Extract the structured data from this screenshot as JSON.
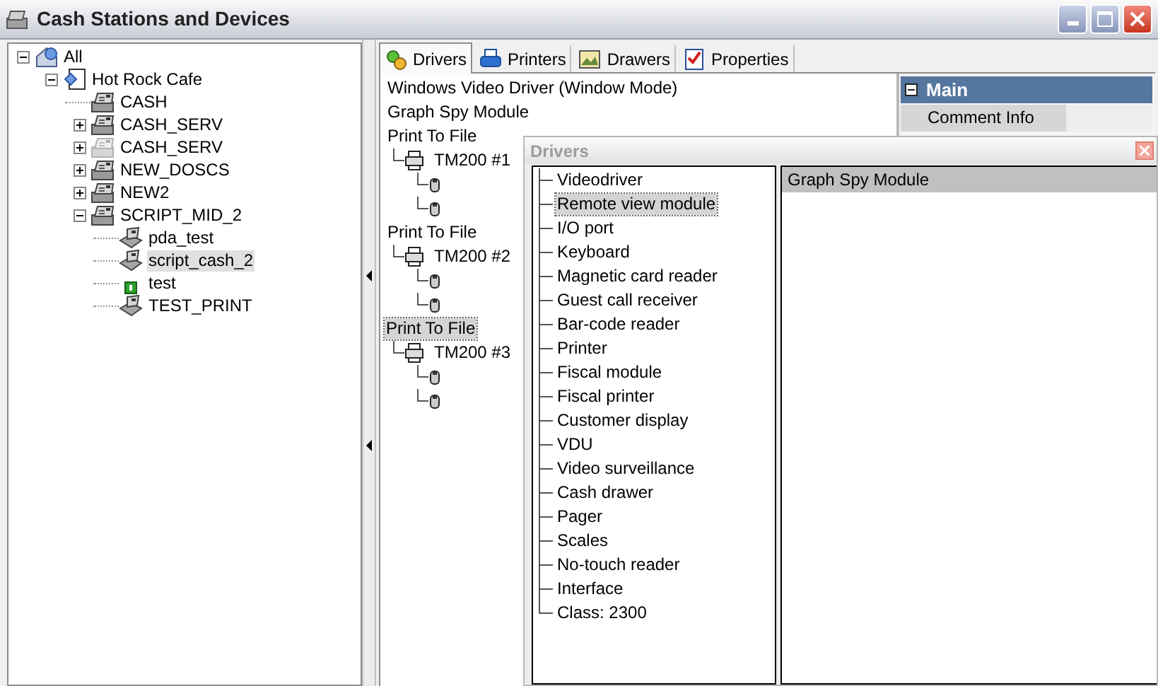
{
  "window": {
    "title": "Cash Stations and Devices"
  },
  "stations_tree": [
    {
      "label": "All",
      "kind": "root",
      "expanded": true,
      "selected": false,
      "children": [
        {
          "label": "Hot Rock Cafe",
          "kind": "site",
          "expanded": true,
          "selected": false,
          "children": [
            {
              "label": "CASH",
              "kind": "station",
              "selected": false,
              "disabled": false
            },
            {
              "label": "CASH_SERV",
              "kind": "station",
              "expanded": false,
              "selected": false,
              "disabled": false
            },
            {
              "label": "CASH_SERV",
              "kind": "station",
              "expanded": false,
              "selected": false,
              "disabled": true
            },
            {
              "label": "NEW_DOSCS",
              "kind": "station",
              "expanded": false,
              "selected": false,
              "disabled": false
            },
            {
              "label": "NEW2",
              "kind": "station",
              "expanded": false,
              "selected": false,
              "disabled": false
            },
            {
              "label": "SCRIPT_MID_2",
              "kind": "station",
              "expanded": true,
              "selected": false,
              "disabled": false,
              "children": [
                {
                  "label": "pda_test",
                  "kind": "terminal",
                  "selected": false
                },
                {
                  "label": "script_cash_2",
                  "kind": "terminal",
                  "selected": true
                },
                {
                  "label": "test",
                  "kind": "module",
                  "selected": false
                },
                {
                  "label": "TEST_PRINT",
                  "kind": "terminal",
                  "selected": false
                }
              ]
            }
          ]
        }
      ]
    }
  ],
  "tabs": [
    {
      "label": "Drivers",
      "kind": "drivers",
      "selected": true
    },
    {
      "label": "Printers",
      "kind": "printers",
      "selected": false
    },
    {
      "label": "Drawers",
      "kind": "drawers",
      "selected": false
    },
    {
      "label": "Properties",
      "kind": "properties",
      "selected": false
    }
  ],
  "drivers_tree": [
    {
      "label": "Windows Video Driver (Window Mode)",
      "selected": false
    },
    {
      "label": "Graph Spy Module",
      "selected": false
    },
    {
      "label": "Print To File",
      "selected": false,
      "children": [
        {
          "label": "TM200 #1",
          "kind": "printer",
          "selected": false,
          "children": [
            {
              "kind": "device"
            },
            {
              "kind": "device"
            }
          ]
        }
      ]
    },
    {
      "label": "Print To File",
      "selected": false,
      "children": [
        {
          "label": "TM200 #2",
          "kind": "printer",
          "selected": false,
          "children": [
            {
              "kind": "device"
            },
            {
              "kind": "device"
            }
          ]
        }
      ]
    },
    {
      "label": "Print To File",
      "selected": true,
      "children": [
        {
          "label": "TM200 #3",
          "kind": "printer",
          "selected": false,
          "children": [
            {
              "kind": "device"
            },
            {
              "kind": "device"
            }
          ]
        }
      ]
    }
  ],
  "properties": {
    "section": "Main",
    "rows": [
      "Comment Info"
    ]
  },
  "dialog": {
    "title": "Drivers",
    "classes": [
      {
        "label": "Videodriver",
        "selected": false
      },
      {
        "label": "Remote view module",
        "selected": true
      },
      {
        "label": "I/O port",
        "selected": false
      },
      {
        "label": "Keyboard",
        "selected": false
      },
      {
        "label": "Magnetic card reader",
        "selected": false
      },
      {
        "label": "Guest call receiver",
        "selected": false
      },
      {
        "label": "Bar-code reader",
        "selected": false
      },
      {
        "label": "Printer",
        "selected": false
      },
      {
        "label": "Fiscal module",
        "selected": false
      },
      {
        "label": "Fiscal printer",
        "selected": false
      },
      {
        "label": "Customer display",
        "selected": false
      },
      {
        "label": "VDU",
        "selected": false
      },
      {
        "label": "Video surveillance",
        "selected": false
      },
      {
        "label": "Cash drawer",
        "selected": false
      },
      {
        "label": "Pager",
        "selected": false
      },
      {
        "label": "Scales",
        "selected": false
      },
      {
        "label": "No-touch reader",
        "selected": false
      },
      {
        "label": "Interface",
        "selected": false
      },
      {
        "label": "Class: 2300",
        "selected": false
      }
    ],
    "modules": [
      "Graph Spy Module"
    ]
  }
}
